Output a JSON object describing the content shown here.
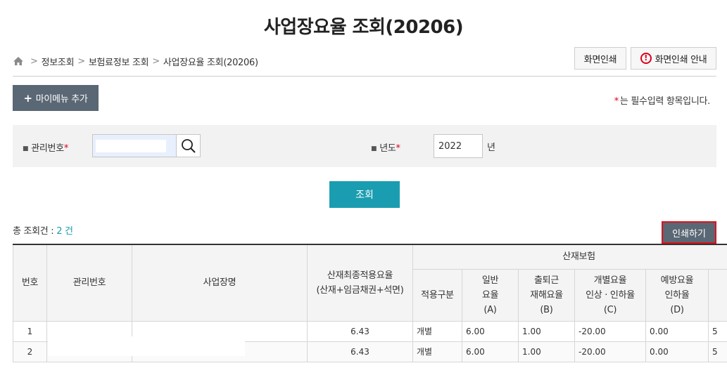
{
  "page": {
    "title": "사업장요율 조회(20206)"
  },
  "breadcrumb": {
    "items": [
      "정보조회",
      "보험료정보 조회",
      "사업장요율 조회(20206)"
    ]
  },
  "top_buttons": {
    "print_screen": "화면인쇄",
    "print_guide": "화면인쇄 안내"
  },
  "mymenu": {
    "label": "마이메뉴 추가"
  },
  "required_note": {
    "star": "*",
    "text": "는 필수입력 항목입니다."
  },
  "search": {
    "mgmt_label": "관리번호",
    "mgmt_value": "",
    "year_label": "년도",
    "year_value": "2022",
    "year_unit": "년",
    "required_mark": "*"
  },
  "query_button": {
    "label": "조회"
  },
  "results": {
    "total_prefix": "총 조회건 : ",
    "total_count": "2 건",
    "print_label": "인쇄하기"
  },
  "table": {
    "headers": {
      "no": "번호",
      "mgmt_no": "관리번호",
      "biz_name": "사업장명",
      "final_rate_line1": "산재최종적용요율",
      "final_rate_line2": "(산재+임금채권+석면)",
      "group": "산재보험",
      "apply_type": "적용구분",
      "general_rate": [
        "일반",
        "요율",
        "(A)"
      ],
      "commute_rate": [
        "출퇴근",
        "재해요율",
        "(B)"
      ],
      "individual_rate": [
        "개별요율",
        "인상 · 인하율",
        "(C)"
      ],
      "prevention_rate": [
        "예방요율",
        "인하율",
        "(D)"
      ]
    },
    "rows": [
      {
        "no": "1",
        "mgmt_no": "",
        "biz_name": "",
        "final_rate": "6.43",
        "apply_type": "개별",
        "general": "6.00",
        "commute": "1.00",
        "individual": "-20.00",
        "prevention": "0.00",
        "extra": "5"
      },
      {
        "no": "2",
        "mgmt_no": "",
        "biz_name": "",
        "final_rate": "6.43",
        "apply_type": "개별",
        "general": "6.00",
        "commute": "1.00",
        "individual": "-20.00",
        "prevention": "0.00",
        "extra": "5"
      }
    ]
  },
  "colors": {
    "accent": "#1a9db0",
    "dark_button": "#5a6774",
    "required": "#d9001b",
    "highlight_border": "#e0101a"
  }
}
